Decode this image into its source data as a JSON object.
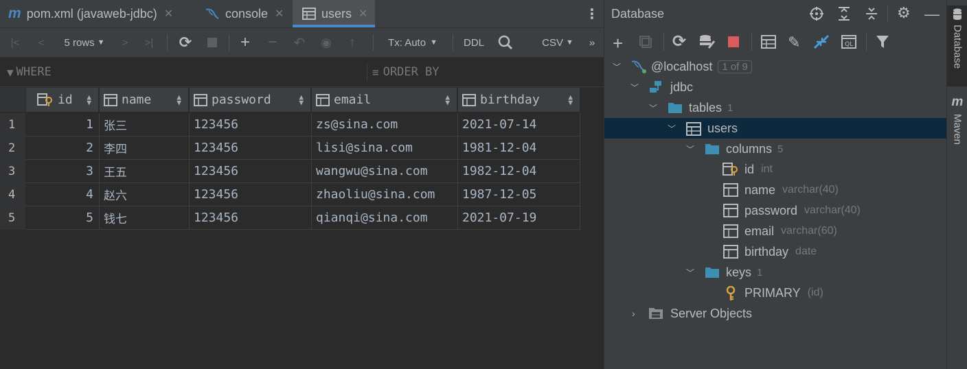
{
  "editor_tabs": [
    {
      "label": "pom.xml (javaweb-jdbc)",
      "icon": "maven-icon",
      "active": false
    },
    {
      "label": "console",
      "icon": "mysql-icon",
      "active": false
    },
    {
      "label": "users",
      "icon": "table-icon",
      "active": true
    }
  ],
  "toolbar": {
    "rows_label": "5 rows",
    "tx_label": "Tx: Auto",
    "ddl_label": "DDL",
    "export_label": "CSV",
    "more": "»"
  },
  "filter": {
    "where": "WHERE",
    "order_by": "ORDER BY"
  },
  "grid": {
    "columns": [
      "id",
      "name",
      "password",
      "email",
      "birthday"
    ],
    "rows": [
      {
        "n": "1",
        "id": "1",
        "name": "张三",
        "password": "123456",
        "email": "zs@sina.com",
        "birthday": "2021-07-14"
      },
      {
        "n": "2",
        "id": "2",
        "name": "李四",
        "password": "123456",
        "email": "lisi@sina.com",
        "birthday": "1981-12-04"
      },
      {
        "n": "3",
        "id": "3",
        "name": "王五",
        "password": "123456",
        "email": "wangwu@sina.com",
        "birthday": "1982-12-04"
      },
      {
        "n": "4",
        "id": "4",
        "name": "赵六",
        "password": "123456",
        "email": "zhaoliu@sina.com",
        "birthday": "1987-12-05"
      },
      {
        "n": "5",
        "id": "5",
        "name": "钱七",
        "password": "123456",
        "email": "qianqi@sina.com",
        "birthday": "2021-07-19"
      }
    ]
  },
  "database_panel": {
    "title": "Database",
    "tree": {
      "host": {
        "label": "@localhost",
        "badge": "1 of 9"
      },
      "schema": "jdbc",
      "tables": {
        "label": "tables",
        "count": "1"
      },
      "table": "users",
      "columns": {
        "label": "columns",
        "count": "5"
      },
      "cols": [
        {
          "name": "id",
          "type": "int"
        },
        {
          "name": "name",
          "type": "varchar(40)"
        },
        {
          "name": "password",
          "type": "varchar(40)"
        },
        {
          "name": "email",
          "type": "varchar(60)"
        },
        {
          "name": "birthday",
          "type": "date"
        }
      ],
      "keys": {
        "label": "keys",
        "count": "1"
      },
      "primary": {
        "name": "PRIMARY",
        "cols": "(id)"
      },
      "server_objects": "Server Objects"
    }
  },
  "side_tabs": {
    "database": "Database",
    "maven": "Maven"
  },
  "colors": {
    "accent": "#4a88c7",
    "selection": "#0d293e",
    "stop_red": "#db5c5c",
    "key_gold": "#d9a343",
    "folder_blue": "#3d8fb3"
  }
}
